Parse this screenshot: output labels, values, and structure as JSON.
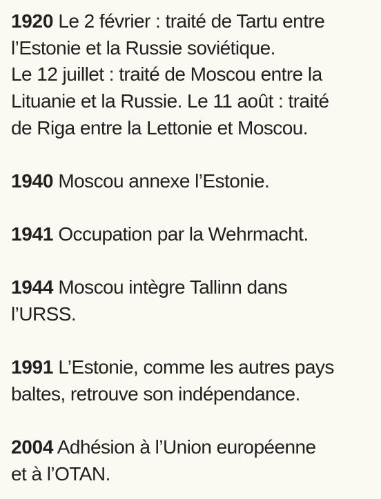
{
  "entries": [
    {
      "year": "1920",
      "lines": [
        "Le 2 février : traité de Tartu entre",
        "l’Estonie et la Russie soviétique.",
        "Le 12 juillet : traité de Moscou entre la",
        "Lituanie et la Russie. Le 11 août : traité",
        "de Riga entre la Lettonie et Moscou."
      ]
    },
    {
      "year": "1940",
      "lines": [
        "Moscou annexe l’Estonie."
      ]
    },
    {
      "year": "1941",
      "lines": [
        "Occupation par la Wehrmacht."
      ]
    },
    {
      "year": "1944",
      "lines": [
        "Moscou intègre Tallinn dans",
        "l’URSS."
      ]
    },
    {
      "year": "1991",
      "lines": [
        "L’Estonie, comme les autres pays",
        "baltes, retrouve son indépendance."
      ]
    },
    {
      "year": "2004",
      "lines": [
        "Adhésion à l’Union européenne",
        "et à l’OTAN."
      ]
    }
  ]
}
